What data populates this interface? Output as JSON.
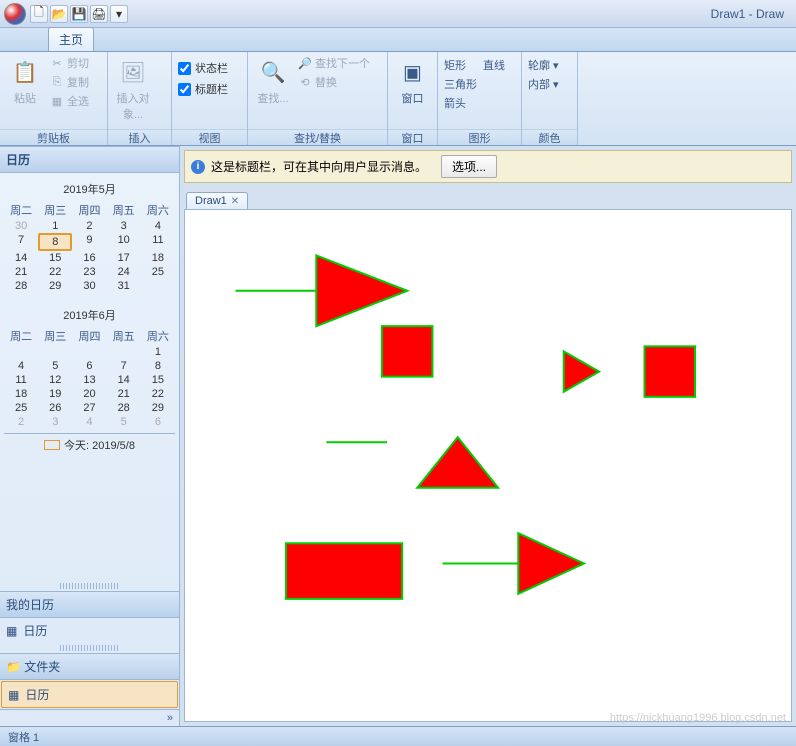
{
  "title": "Draw1 - Draw",
  "tabs": {
    "home": "主页"
  },
  "ribbon": {
    "clipboard": {
      "label": "剪贴板",
      "paste": "粘贴",
      "cut": "剪切",
      "copy": "复制",
      "selectall": "全选"
    },
    "insert": {
      "label": "插入",
      "insert_obj": "插入对象..."
    },
    "view": {
      "label": "视图",
      "statusbar": "状态栏",
      "titlebar": "标题栏"
    },
    "find": {
      "label": "查找/替换",
      "find": "查找...",
      "find_next": "查找下一个",
      "replace": "替换"
    },
    "window": {
      "label": "窗口",
      "window_btn": "窗口"
    },
    "shape": {
      "label": "图形",
      "rect": "矩形",
      "triangle": "三角形",
      "arrow": "箭头",
      "line": "直线"
    },
    "color": {
      "label": "颜色",
      "outline": "轮廓",
      "fill": "内部"
    }
  },
  "msgbar": {
    "text": "这是标题栏，可在其中向用户显示消息。",
    "options": "选项..."
  },
  "doc_tab": "Draw1",
  "sidebar": {
    "calendar_hdr": "日历",
    "month1": {
      "title": "2019年5月",
      "dow": [
        "周二",
        "周三",
        "周四",
        "周五",
        "周六"
      ],
      "rows": [
        [
          30,
          1,
          2,
          3,
          4
        ],
        [
          7,
          8,
          9,
          10,
          11
        ],
        [
          14,
          15,
          16,
          17,
          18
        ],
        [
          21,
          22,
          23,
          24,
          25
        ],
        [
          28,
          29,
          30,
          31,
          ""
        ]
      ],
      "dim": [
        [
          0,
          0
        ]
      ],
      "selected": [
        1,
        1
      ]
    },
    "month2": {
      "title": "2019年6月",
      "dow": [
        "周二",
        "周三",
        "周四",
        "周五",
        "周六"
      ],
      "rows": [
        [
          "",
          "",
          "",
          "",
          1
        ],
        [
          4,
          5,
          6,
          7,
          8
        ],
        [
          11,
          12,
          13,
          14,
          15
        ],
        [
          18,
          19,
          20,
          21,
          22
        ],
        [
          25,
          26,
          27,
          28,
          29
        ],
        [
          2,
          3,
          4,
          5,
          6
        ]
      ],
      "dim_row": 5
    },
    "today": "今天: 2019/5/8",
    "mycal_hdr": "我的日历",
    "mycal_item": "日历",
    "folder_hdr": "文件夹",
    "folder_item": "日历"
  },
  "status": "窗格 1",
  "watermark": "https://nickhuang1996.blog.csdn.net"
}
